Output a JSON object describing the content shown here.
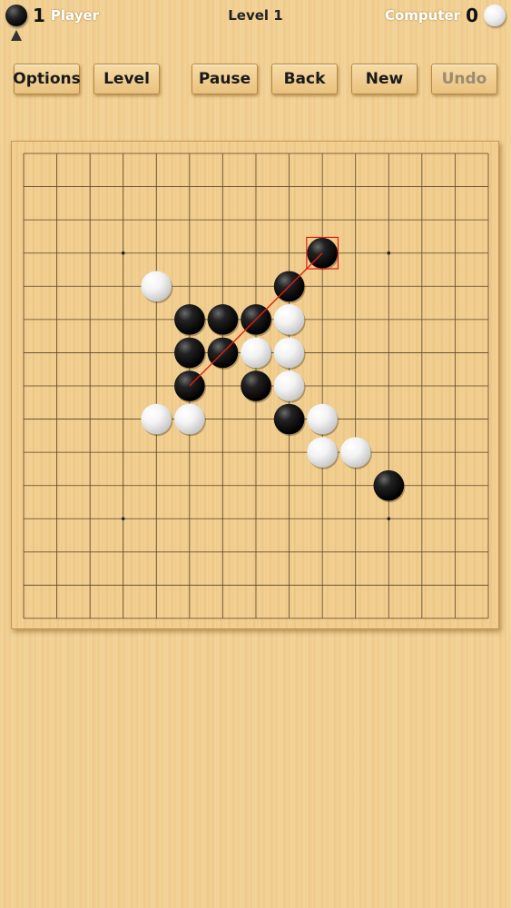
{
  "header": {
    "player_score": "1",
    "player_label": "Player",
    "level_title": "Level 1",
    "computer_label": "Computer",
    "computer_score": "0"
  },
  "toolbar": {
    "options_label": "Options",
    "level_label": "Level",
    "pause_label": "Pause",
    "back_label": "Back",
    "new_label": "New",
    "undo_label": "Undo"
  },
  "board": {
    "size": 15,
    "star_points": [
      [
        3,
        3
      ],
      [
        11,
        3
      ],
      [
        3,
        11
      ],
      [
        11,
        11
      ]
    ],
    "stones": [
      {
        "col": 9,
        "row": 3,
        "color": "black",
        "last": true
      },
      {
        "col": 4,
        "row": 4,
        "color": "white"
      },
      {
        "col": 8,
        "row": 4,
        "color": "black"
      },
      {
        "col": 5,
        "row": 5,
        "color": "black"
      },
      {
        "col": 6,
        "row": 5,
        "color": "black"
      },
      {
        "col": 7,
        "row": 5,
        "color": "black"
      },
      {
        "col": 8,
        "row": 5,
        "color": "white"
      },
      {
        "col": 5,
        "row": 6,
        "color": "black"
      },
      {
        "col": 6,
        "row": 6,
        "color": "black"
      },
      {
        "col": 7,
        "row": 6,
        "color": "white"
      },
      {
        "col": 8,
        "row": 6,
        "color": "white"
      },
      {
        "col": 5,
        "row": 7,
        "color": "black"
      },
      {
        "col": 7,
        "row": 7,
        "color": "black"
      },
      {
        "col": 8,
        "row": 7,
        "color": "white"
      },
      {
        "col": 4,
        "row": 8,
        "color": "white"
      },
      {
        "col": 5,
        "row": 8,
        "color": "white"
      },
      {
        "col": 8,
        "row": 8,
        "color": "black"
      },
      {
        "col": 9,
        "row": 8,
        "color": "white"
      },
      {
        "col": 9,
        "row": 9,
        "color": "white"
      },
      {
        "col": 10,
        "row": 9,
        "color": "white"
      },
      {
        "col": 11,
        "row": 10,
        "color": "black"
      }
    ],
    "win_line": {
      "from": [
        5,
        7
      ],
      "to": [
        9,
        3
      ]
    },
    "win_line_color": "#e02010",
    "last_move_marker_color": "#e02010"
  }
}
